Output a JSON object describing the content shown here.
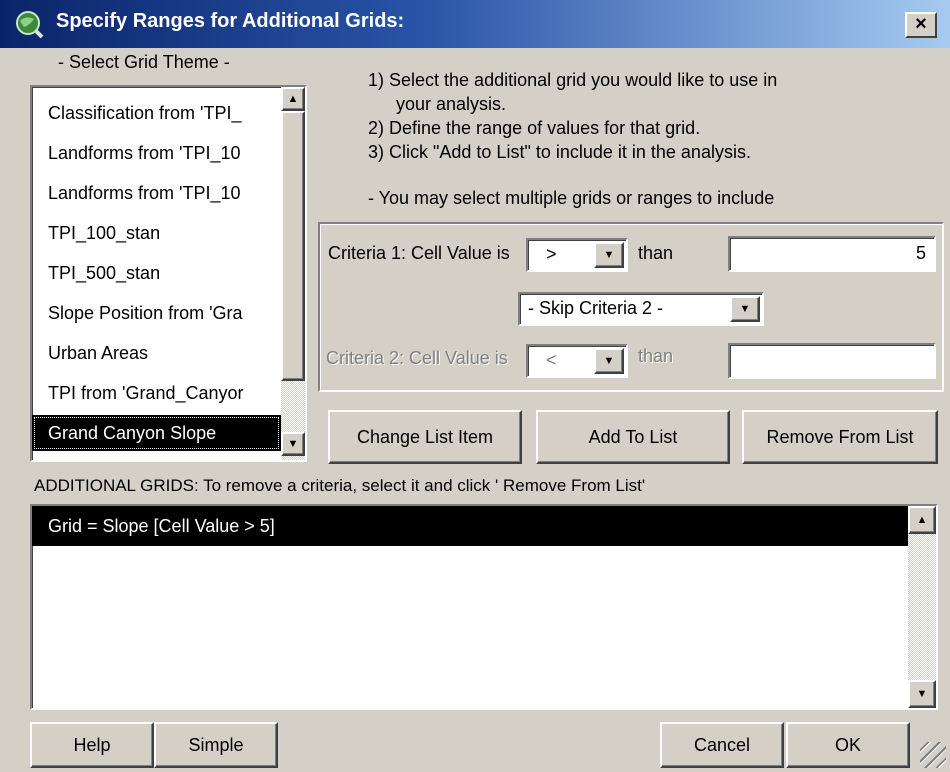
{
  "window": {
    "title": "Specify Ranges for Additional Grids:",
    "close": "×"
  },
  "theme_panel": {
    "label": "- Select Grid Theme -",
    "items": [
      "Classification from 'TPI_",
      "Landforms from 'TPI_10",
      "Landforms from 'TPI_10",
      "TPI_100_stan",
      "TPI_500_stan",
      "Slope Position from 'Gra",
      "Urban Areas",
      "TPI from 'Grand_Canyor",
      "Grand Canyon Slope"
    ],
    "selected_index": 8
  },
  "instructions": {
    "step1a": "1) Select the additional grid you would like to use in",
    "step1b": "your analysis.",
    "step2": "2) Define the range of values for that grid.",
    "step3": "3) Click \"Add to List\" to include it in the analysis.",
    "note": "- You may select multiple grids or ranges to include"
  },
  "criteria1": {
    "label": "Criteria 1:  Cell Value is",
    "operator": ">",
    "than": "than",
    "value": "5"
  },
  "skip_select": {
    "value": "- Skip Criteria 2 -"
  },
  "criteria2": {
    "label": "Criteria 2:  Cell Value is",
    "operator": "<",
    "than": "than",
    "value": ""
  },
  "buttons": {
    "change": "Change List Item",
    "add": "Add To List",
    "remove": "Remove From List",
    "help": "Help",
    "simple": "Simple",
    "cancel": "Cancel",
    "ok": "OK"
  },
  "additional_grids": {
    "label": "ADDITIONAL GRIDS:  To remove a criteria, select it and click ' Remove From List'",
    "items": [
      "Grid = Slope [Cell Value  > 5]"
    ]
  },
  "colors": {
    "selection": "#000000",
    "title_start": "#0a246a",
    "title_end": "#a6caf0"
  },
  "icons": {
    "app": "globe-search-icon",
    "up": "scroll-up-icon",
    "down": "scroll-down-icon"
  }
}
